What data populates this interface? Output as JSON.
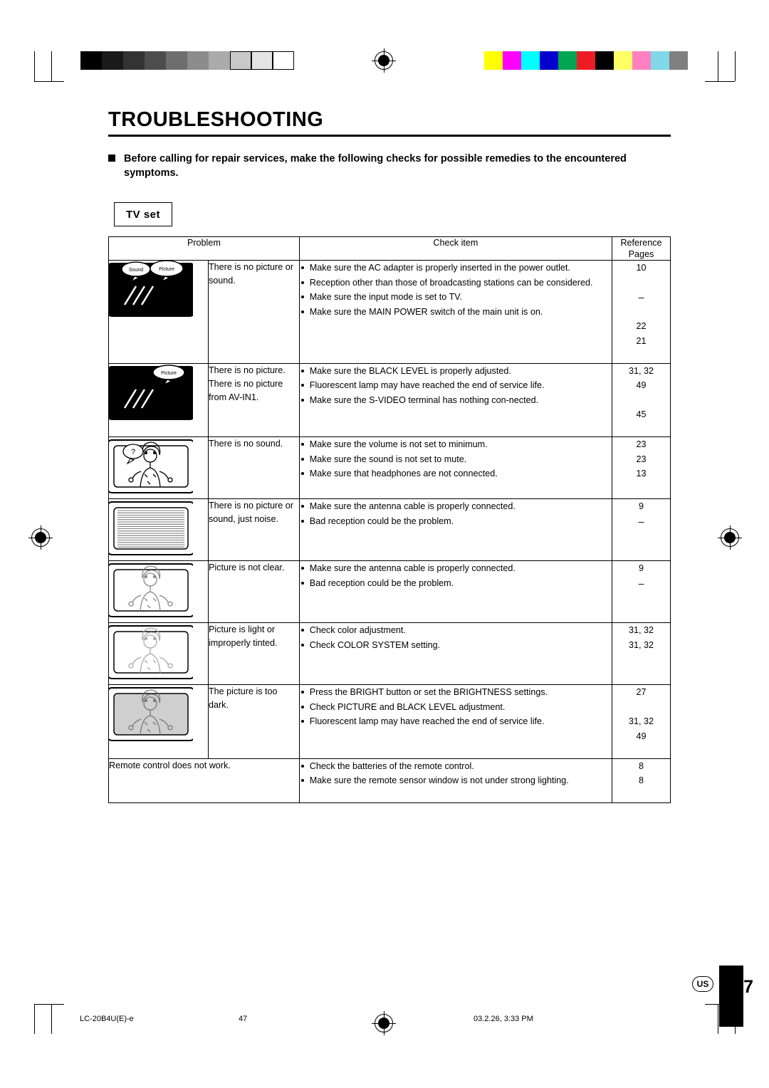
{
  "document": {
    "title": "TROUBLESHOOTING",
    "intro": "Before calling for repair services, make the following checks for possible remedies to the encountered symptoms.",
    "section_label": "TV set"
  },
  "table": {
    "headers": {
      "problem": "Problem",
      "check_item": "Check item",
      "reference_line1": "Reference",
      "reference_line2": "Pages"
    },
    "rows": [
      {
        "icon": "tv-no-picture-no-sound-icon",
        "icon_labels": [
          "Sound",
          "Picture"
        ],
        "problem": "There is no picture or sound.",
        "checks": [
          "Make sure the AC adapter is properly inserted in the power outlet.",
          "Reception other than those of broadcasting stations can be considered.",
          "Make sure the input mode is set to TV.",
          "Make sure the MAIN POWER switch of the main unit is on."
        ],
        "refs": [
          "10",
          "–",
          "22",
          "21"
        ]
      },
      {
        "icon": "tv-no-picture-icon",
        "icon_labels": [
          "Picture"
        ],
        "problem": "There is no picture. There is no picture from AV-IN1.",
        "checks": [
          "Make sure the BLACK LEVEL is properly adjusted.",
          "Fluorescent lamp may have reached the end of service life.",
          "Make sure the S-VIDEO terminal has nothing con-nected."
        ],
        "refs": [
          "31, 32",
          "49",
          "45"
        ]
      },
      {
        "icon": "tv-no-sound-icon",
        "icon_labels": [],
        "problem": "There is no sound.",
        "checks": [
          "Make sure the volume is not set to minimum.",
          "Make sure the sound is not set to mute.",
          "Make sure that headphones are not connected."
        ],
        "refs": [
          "23",
          "23",
          "13"
        ]
      },
      {
        "icon": "tv-noise-icon",
        "icon_labels": [],
        "problem": "There is no picture or sound, just noise.",
        "checks": [
          "Make sure the antenna cable is properly connected.",
          "Bad reception could be the problem."
        ],
        "refs": [
          "9",
          "–"
        ]
      },
      {
        "icon": "tv-unclear-picture-icon",
        "icon_labels": [],
        "problem": "Picture is not clear.",
        "checks": [
          "Make sure the antenna cable is properly connected.",
          "Bad reception could be the problem."
        ],
        "refs": [
          "9",
          "–"
        ]
      },
      {
        "icon": "tv-tinted-picture-icon",
        "icon_labels": [],
        "problem": "Picture is light or improperly tinted.",
        "checks": [
          "Check color adjustment.",
          "Check COLOR SYSTEM setting."
        ],
        "refs": [
          "31, 32",
          "31, 32"
        ]
      },
      {
        "icon": "tv-dark-picture-icon",
        "icon_labels": [],
        "problem": "The picture is too dark.",
        "checks": [
          "Press the BRIGHT button or set the BRIGHTNESS settings.",
          "Check PICTURE and BLACK LEVEL adjustment.",
          "Fluorescent lamp may have reached the end of service life."
        ],
        "refs": [
          "27",
          "31, 32",
          "49"
        ]
      },
      {
        "icon": "",
        "icon_labels": [],
        "problem": "Remote control does not work.",
        "checks": [
          "Check the batteries of the remote control.",
          "Make sure the remote sensor window is not under strong lighting."
        ],
        "refs": [
          "8",
          "8"
        ]
      }
    ]
  },
  "footer": {
    "file_name": "LC-20B4U(E)-e",
    "page_marker": "47",
    "timestamp": "03.2.26, 3:33 PM",
    "region_mark": "US",
    "page_number": "47"
  },
  "print_marks": {
    "gray_steps": [
      "#000000",
      "#1a1a1a",
      "#333333",
      "#4d4d4d",
      "#6e6e6e",
      "#8c8c8c",
      "#ababab",
      "#c9c9c9",
      "#e4e4e4",
      "#ffffff"
    ],
    "color_patches": [
      "#ffff00",
      "#ff00ff",
      "#00ffff",
      "#0000cc",
      "#00a651",
      "#ed1c24",
      "#000000",
      "#ffff66",
      "#ff80c0",
      "#80d8e8",
      "#808080"
    ]
  }
}
